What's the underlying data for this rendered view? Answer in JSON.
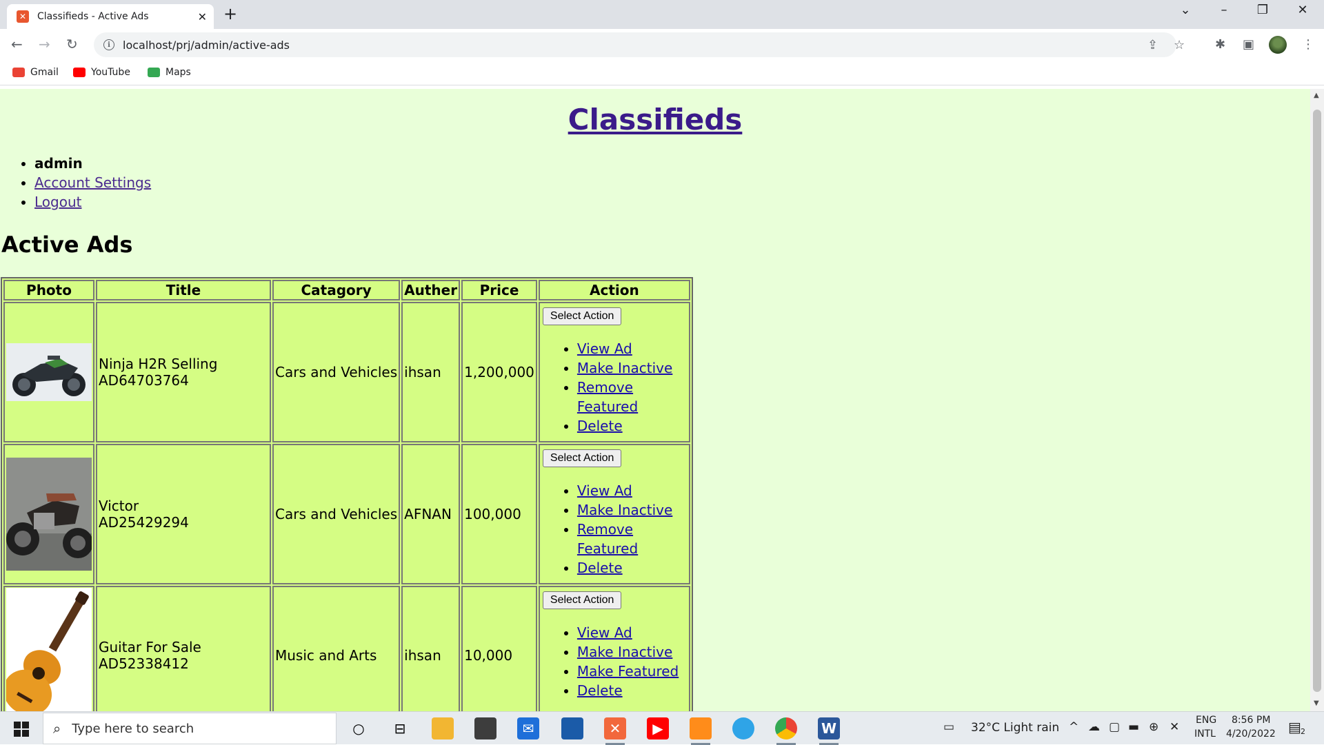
{
  "browser": {
    "tab_title": "Classifieds - Active Ads",
    "url": "localhost/prj/admin/active-ads",
    "bookmarks": [
      {
        "label": "Gmail",
        "color": "#ea4335"
      },
      {
        "label": "YouTube",
        "color": "#ff0000"
      },
      {
        "label": "Maps",
        "color": "#34a853"
      }
    ]
  },
  "page": {
    "site_title": "Classifieds",
    "user_menu": {
      "username": "admin",
      "account_settings": "Account Settings",
      "logout": "Logout"
    },
    "section_title": "Active Ads",
    "table": {
      "headers": [
        "Photo",
        "Title",
        "Catagory",
        "Auther",
        "Price",
        "Action"
      ],
      "rows": [
        {
          "photo_icon": "motorcycle-photo",
          "title": "Ninja H2R Selling",
          "ad_id": "AD64703764",
          "category": "Cars and Vehicles",
          "author": "ihsan",
          "price": "1,200,000",
          "select_label": "Select Action",
          "actions": [
            "View Ad",
            "Make Inactive",
            "Remove Featured",
            "Delete"
          ]
        },
        {
          "photo_icon": "old-motorcycle-photo",
          "title": "Victor",
          "ad_id": "AD25429294",
          "category": "Cars and Vehicles",
          "author": "AFNAN",
          "price": "100,000",
          "select_label": "Select Action",
          "actions": [
            "View Ad",
            "Make Inactive",
            "Remove Featured",
            "Delete"
          ]
        },
        {
          "photo_icon": "guitar-photo",
          "title": "Guitar For Sale",
          "ad_id": "AD52338412",
          "category": "Music and Arts",
          "author": "ihsan",
          "price": "10,000",
          "select_label": "Select Action",
          "actions": [
            "View Ad",
            "Make Inactive",
            "Make Featured",
            "Delete"
          ]
        }
      ]
    }
  },
  "taskbar": {
    "search_placeholder": "Type here to search",
    "weather": "32°C  Light rain",
    "lang_top": "ENG",
    "lang_bottom": "INTL",
    "time": "8:56 PM",
    "date": "4/20/2022",
    "notification_count": "2"
  }
}
